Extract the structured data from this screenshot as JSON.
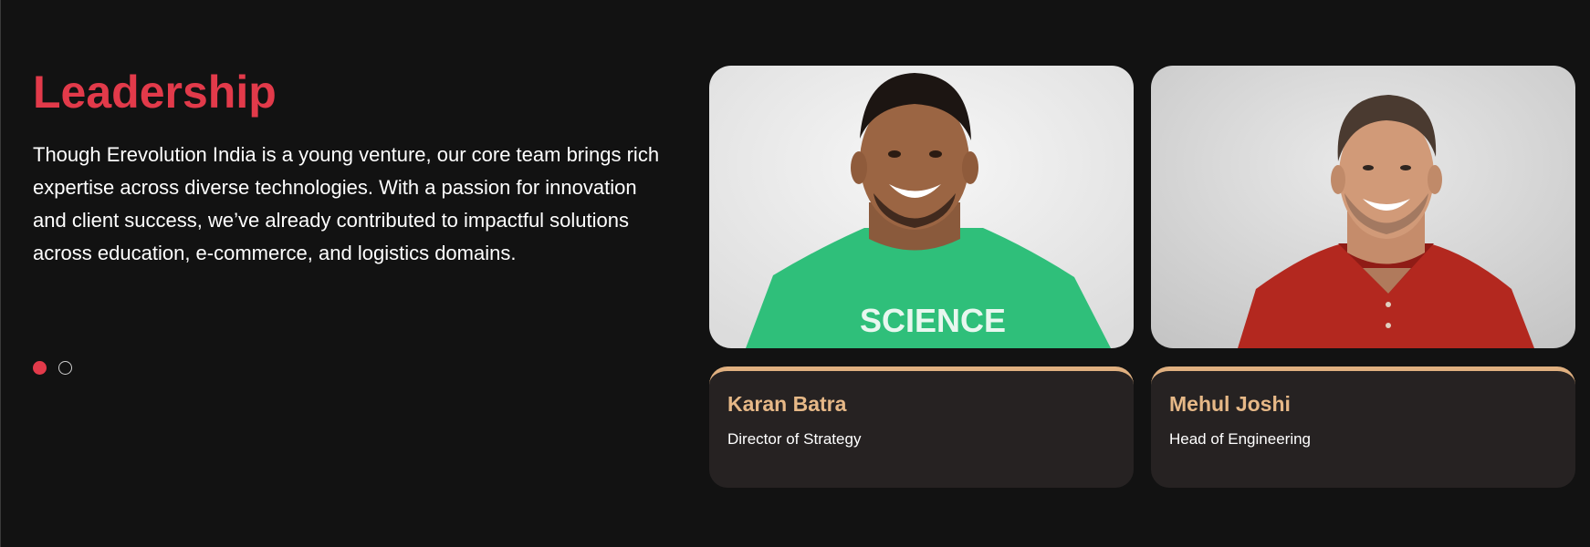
{
  "section": {
    "title": "Leadership",
    "description": "Though Erevolution India is a young venture, our core team brings rich expertise across diverse technologies. With a passion for innovation and client success, we’ve already contributed to impactful solutions across education, e-commerce, and logistics domains."
  },
  "carousel": {
    "active_index": 0,
    "dot_count": 2
  },
  "team": [
    {
      "name": "Karan Batra",
      "role": "Director of Strategy",
      "shirt_text": "SCIENCE",
      "shirt_color": "#2fbf7a"
    },
    {
      "name": "Mehul Joshi",
      "role": "Head of Engineering",
      "shirt_color": "#b3281f"
    }
  ],
  "colors": {
    "background": "#121212",
    "accent": "#e23a4a",
    "card_background": "#262222",
    "name_gold": "#e6b887"
  }
}
